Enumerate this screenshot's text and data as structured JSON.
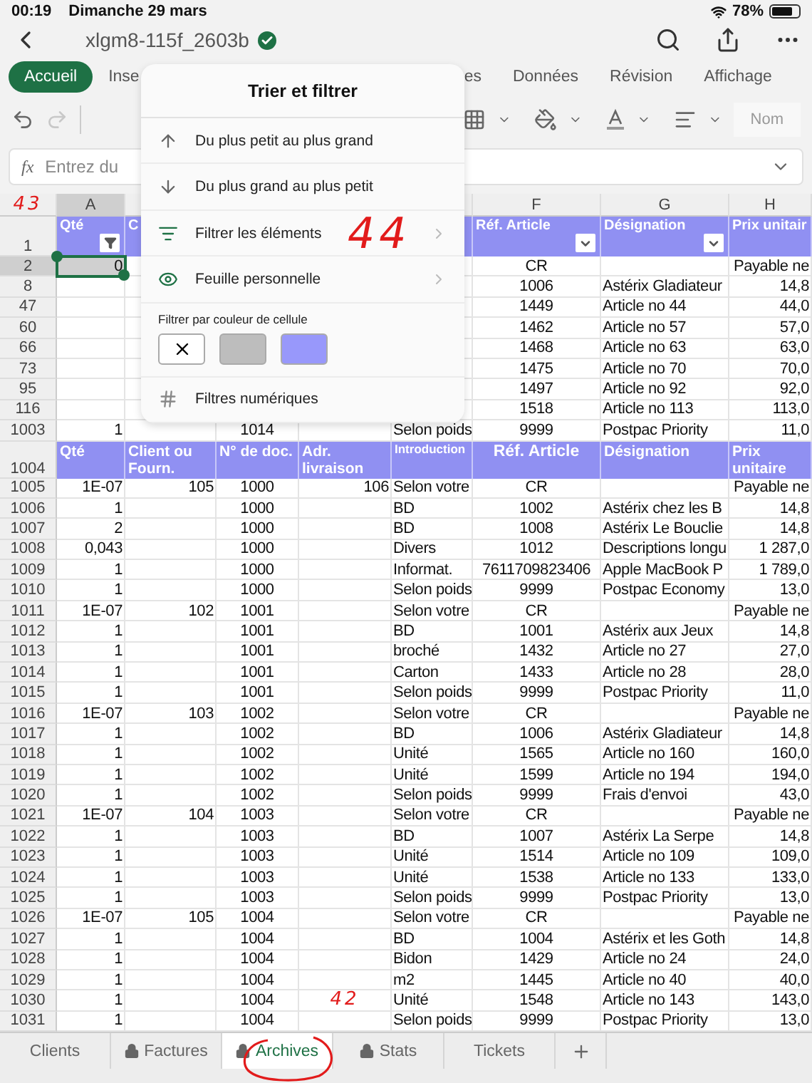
{
  "status_bar": {
    "time": "00:19",
    "date": "Dimanche 29 mars",
    "battery": "78%"
  },
  "title_bar": {
    "title": "xlgm8-115f_2603b",
    "saved": true
  },
  "ribbon_tabs": [
    {
      "label": "Accueil",
      "selected": true
    },
    {
      "label": "Inse",
      "selected": false
    },
    {
      "label": "es",
      "selected": false
    },
    {
      "label": "Données",
      "selected": false
    },
    {
      "label": "Révision",
      "selected": false
    },
    {
      "label": "Affichage",
      "selected": false
    }
  ],
  "toolbar": {
    "undo_disabled": false,
    "redo_disabled": true,
    "style_button": "Nom"
  },
  "formula_bar": {
    "function_label": "fx",
    "placeholder": "Entrez du"
  },
  "sheet": {
    "column_letters": [
      {
        "letter": "A",
        "selected": true
      },
      {
        "letter": "F",
        "selected": false
      },
      {
        "letter": "G",
        "selected": false
      },
      {
        "letter": "H",
        "selected": false
      }
    ],
    "header_row": {
      "number": "1",
      "cells": [
        {
          "text": "Qté",
          "filtered": true
        },
        {
          "text": "C"
        },
        null,
        null,
        null,
        {
          "text": "Réf. Article",
          "filtered": false
        },
        {
          "text": "Désignation",
          "filtered": false
        },
        {
          "text": "Prix unitair"
        }
      ]
    },
    "top_rows": [
      {
        "number": "2",
        "selected": true,
        "cells": [
          "0",
          null,
          null,
          null,
          null,
          "CR",
          null,
          "Payable ne"
        ]
      },
      {
        "number": "8",
        "selected": false,
        "cells": [
          null,
          null,
          null,
          null,
          null,
          "1006",
          "Astérix Gladiateur",
          "14,8"
        ]
      },
      {
        "number": "47",
        "selected": false,
        "cells": [
          null,
          null,
          null,
          null,
          null,
          "1449",
          "Article no 44",
          "44,0"
        ]
      },
      {
        "number": "60",
        "selected": false,
        "cells": [
          null,
          null,
          null,
          null,
          null,
          "1462",
          "Article no 57",
          "57,0"
        ]
      },
      {
        "number": "66",
        "selected": false,
        "cells": [
          null,
          null,
          null,
          null,
          null,
          "1468",
          "Article no 63",
          "63,0"
        ]
      },
      {
        "number": "73",
        "selected": false,
        "cells": [
          null,
          null,
          null,
          null,
          null,
          "1475",
          "Article no 70",
          "70,0"
        ]
      },
      {
        "number": "95",
        "selected": false,
        "cells": [
          null,
          null,
          null,
          null,
          null,
          "1497",
          "Article no 92",
          "92,0"
        ]
      },
      {
        "number": "116",
        "selected": false,
        "cells": [
          null,
          null,
          null,
          null,
          null,
          "1518",
          "Article no 113",
          "113,0"
        ]
      },
      {
        "number": "1003",
        "selected": false,
        "cells": [
          "1",
          null,
          "1014",
          null,
          "Selon poids",
          "9999",
          "Postpac Priority",
          "11,0"
        ]
      }
    ],
    "second_header": {
      "number": "1004",
      "cells": [
        "Qté",
        "Client ou Fourn.",
        "N° de doc.",
        "Adr. livraison",
        "Introduction",
        "Réf. Article",
        "Désignation",
        "Prix unitaire"
      ]
    },
    "rows": [
      {
        "number": "1005",
        "cells": [
          "1E-07",
          "105",
          "1000",
          "106",
          "Selon votre",
          "CR",
          null,
          "Payable ne"
        ]
      },
      {
        "number": "1006",
        "cells": [
          "1",
          null,
          "1000",
          null,
          "BD",
          "1002",
          "Astérix chez les B",
          "14,8"
        ]
      },
      {
        "number": "1007",
        "cells": [
          "2",
          null,
          "1000",
          null,
          "BD",
          "1008",
          "Astérix Le Bouclie",
          "14,8"
        ]
      },
      {
        "number": "1008",
        "cells": [
          "0,043",
          null,
          "1000",
          null,
          "Divers",
          "1012",
          "Descriptions longu",
          "1 287,0"
        ]
      },
      {
        "number": "1009",
        "cells": [
          "1",
          null,
          "1000",
          null,
          "Informat.",
          "7611709823406",
          "Apple MacBook P",
          "1 789,0"
        ]
      },
      {
        "number": "1010",
        "cells": [
          "1",
          null,
          "1000",
          null,
          "Selon poids",
          "9999",
          "Postpac Economy",
          "13,0"
        ]
      },
      {
        "number": "1011",
        "cells": [
          "1E-07",
          "102",
          "1001",
          null,
          "Selon votre",
          "CR",
          null,
          "Payable ne"
        ]
      },
      {
        "number": "1012",
        "cells": [
          "1",
          null,
          "1001",
          null,
          "BD",
          "1001",
          "Astérix aux Jeux",
          "14,8"
        ]
      },
      {
        "number": "1013",
        "cells": [
          "1",
          null,
          "1001",
          null,
          "broché",
          "1432",
          "Article no 27",
          "27,0"
        ]
      },
      {
        "number": "1014",
        "cells": [
          "1",
          null,
          "1001",
          null,
          "Carton",
          "1433",
          "Article no 28",
          "28,0"
        ]
      },
      {
        "number": "1015",
        "cells": [
          "1",
          null,
          "1001",
          null,
          "Selon poids",
          "9999",
          "Postpac Priority",
          "11,0"
        ]
      },
      {
        "number": "1016",
        "cells": [
          "1E-07",
          "103",
          "1002",
          null,
          "Selon votre",
          "CR",
          null,
          "Payable ne"
        ]
      },
      {
        "number": "1017",
        "cells": [
          "1",
          null,
          "1002",
          null,
          "BD",
          "1006",
          "Astérix Gladiateur",
          "14,8"
        ]
      },
      {
        "number": "1018",
        "cells": [
          "1",
          null,
          "1002",
          null,
          "Unité",
          "1565",
          "Article no 160",
          "160,0"
        ]
      },
      {
        "number": "1019",
        "cells": [
          "1",
          null,
          "1002",
          null,
          "Unité",
          "1599",
          "Article no 194",
          "194,0"
        ]
      },
      {
        "number": "1020",
        "cells": [
          "1",
          null,
          "1002",
          null,
          "Selon poids",
          "9999",
          "Frais d'envoi",
          "43,0"
        ]
      },
      {
        "number": "1021",
        "cells": [
          "1E-07",
          "104",
          "1003",
          null,
          "Selon votre",
          "CR",
          null,
          "Payable ne"
        ]
      },
      {
        "number": "1022",
        "cells": [
          "1",
          null,
          "1003",
          null,
          "BD",
          "1007",
          "Astérix La Serpe",
          "14,8"
        ]
      },
      {
        "number": "1023",
        "cells": [
          "1",
          null,
          "1003",
          null,
          "Unité",
          "1514",
          "Article no 109",
          "109,0"
        ]
      },
      {
        "number": "1024",
        "cells": [
          "1",
          null,
          "1003",
          null,
          "Unité",
          "1538",
          "Article no 133",
          "133,0"
        ]
      },
      {
        "number": "1025",
        "cells": [
          "1",
          null,
          "1003",
          null,
          "Selon poids",
          "9999",
          "Postpac Priority",
          "13,0"
        ]
      },
      {
        "number": "1026",
        "cells": [
          "1E-07",
          "105",
          "1004",
          null,
          "Selon votre",
          "CR",
          null,
          "Payable ne"
        ]
      },
      {
        "number": "1027",
        "cells": [
          "1",
          null,
          "1004",
          null,
          "BD",
          "1004",
          "Astérix et les Goth",
          "14,8"
        ]
      },
      {
        "number": "1028",
        "cells": [
          "1",
          null,
          "1004",
          null,
          "Bidon",
          "1429",
          "Article no 24",
          "24,0"
        ]
      },
      {
        "number": "1029",
        "cells": [
          "1",
          null,
          "1004",
          null,
          "m2",
          "1445",
          "Article no 40",
          "40,0"
        ]
      },
      {
        "number": "1030",
        "cells": [
          "1",
          null,
          "1004",
          null,
          "Unité",
          "1548",
          "Article no 143",
          "143,0"
        ]
      },
      {
        "number": "1031",
        "cells": [
          "1",
          null,
          "1004",
          null,
          "Selon poids",
          "9999",
          "Postpac Priority",
          "13,0"
        ]
      }
    ]
  },
  "sort_filter_popup": {
    "title": "Trier et filtrer",
    "items": [
      {
        "kind": "sort_asc",
        "label": "Du plus petit au plus grand"
      },
      {
        "kind": "sort_desc",
        "label": "Du plus grand au plus petit"
      },
      {
        "kind": "filter",
        "label": "Filtrer les éléments"
      },
      {
        "kind": "personal",
        "label": "Feuille personnelle"
      }
    ],
    "color_filter": {
      "label": "Filtrer par couleur de cellule",
      "swatches": [
        {
          "kind": "none"
        },
        {
          "kind": "color",
          "color": "#bdbdbd"
        },
        {
          "kind": "color",
          "color": "#9898fb"
        }
      ]
    },
    "numeric_item": {
      "kind": "numeric",
      "label": "Filtres numériques"
    }
  },
  "sheet_tabs": [
    {
      "label": "Clients",
      "locked": false,
      "selected": false
    },
    {
      "label": "Factures",
      "locked": true,
      "selected": false
    },
    {
      "label": "Archives",
      "locked": true,
      "selected": true
    },
    {
      "label": "Stats",
      "locked": true,
      "selected": false
    },
    {
      "label": "Tickets",
      "locked": false,
      "selected": false
    }
  ],
  "handwritten_marks": [
    {
      "text": "43"
    },
    {
      "text": "44"
    },
    {
      "text": "42"
    }
  ]
}
